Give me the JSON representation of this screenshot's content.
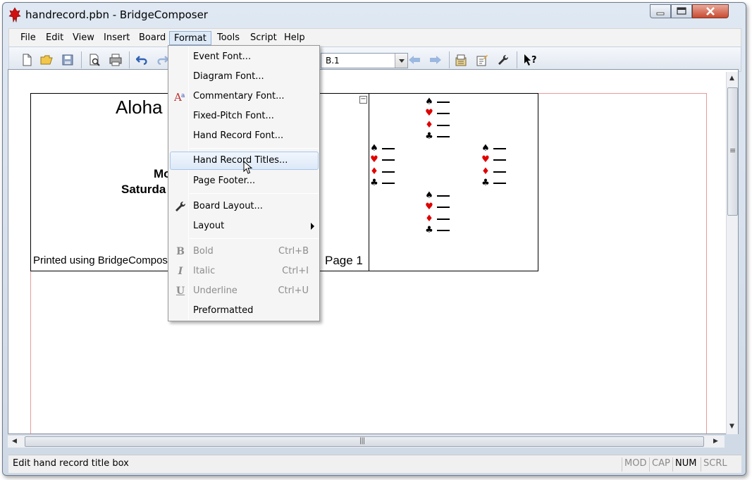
{
  "window": {
    "title": "handrecord.pbn - BridgeComposer"
  },
  "menubar": {
    "items": [
      "File",
      "Edit",
      "View",
      "Insert",
      "Board",
      "Format",
      "Tools",
      "Script",
      "Help"
    ],
    "active": "Format"
  },
  "toolbar": {
    "board_value": "B.1",
    "icons": [
      "new-icon",
      "open-icon",
      "save-icon",
      "print-preview-icon",
      "print-icon",
      "undo-icon",
      "redo-icon",
      "previous-board-icon",
      "next-board-icon",
      "board-properties-icon",
      "edit-icon",
      "settings-wrench-icon",
      "context-help-icon"
    ]
  },
  "document": {
    "title": "Aloha",
    "line1": "Mo",
    "line2": "Saturda",
    "printed_text": "Printed using BridgeCompose",
    "page_label": "Page 1",
    "collapse_glyph": "−"
  },
  "hand_diagram": {
    "suits": [
      "♠",
      "♥",
      "♦",
      "♣"
    ],
    "suit_colors": [
      "#000000",
      "#e00000",
      "#e00000",
      "#000000"
    ]
  },
  "format_menu": {
    "groups": [
      [
        {
          "label": "Event Font..."
        },
        {
          "label": "Diagram Font..."
        },
        {
          "label": "Commentary Font...",
          "icon": "font-icon"
        },
        {
          "label": "Fixed-Pitch Font..."
        },
        {
          "label": "Hand Record Font..."
        }
      ],
      [
        {
          "label": "Hand Record Titles...",
          "hover": true
        },
        {
          "label": "Page Footer..."
        }
      ],
      [
        {
          "label": "Board Layout...",
          "icon": "wrench-icon"
        },
        {
          "label": "Layout",
          "submenu": true
        }
      ],
      [
        {
          "label": "Bold",
          "shortcut": "Ctrl+B",
          "disabled": true,
          "icon": "bold-icon"
        },
        {
          "label": "Italic",
          "shortcut": "Ctrl+I",
          "disabled": true,
          "icon": "italic-icon"
        },
        {
          "label": "Underline",
          "shortcut": "Ctrl+U",
          "disabled": true,
          "icon": "underline-icon"
        },
        {
          "label": "Preformatted"
        }
      ]
    ],
    "icon_glyphs": {
      "bold-icon": "B",
      "italic-icon": "I",
      "underline-icon": "U"
    }
  },
  "statusbar": {
    "text": "Edit hand record title box",
    "indicators": [
      {
        "label": "MOD",
        "on": false
      },
      {
        "label": "CAP",
        "on": false
      },
      {
        "label": "NUM",
        "on": true
      },
      {
        "label": "SCRL",
        "on": false
      }
    ]
  },
  "scrollbars": {
    "h_grip": "|||",
    "v_grip": "≡"
  }
}
